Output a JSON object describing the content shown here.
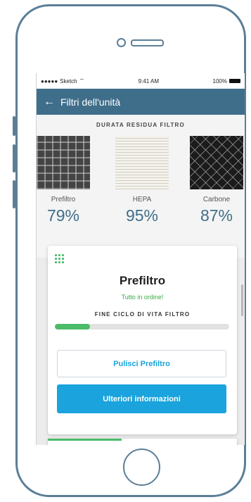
{
  "status_bar": {
    "carrier": "Sketch",
    "time": "9:41 AM",
    "battery": "100%"
  },
  "header": {
    "title": "Filtri dell'unità",
    "back_icon": "arrow-left-icon"
  },
  "filters": {
    "heading": "DURATA RESIDUA FILTRO",
    "items": [
      {
        "name": "Prefiltro",
        "percent": "79%"
      },
      {
        "name": "HEPA",
        "percent": "95%"
      },
      {
        "name": "Carbone",
        "percent": "87%"
      }
    ]
  },
  "card": {
    "title": "Prefiltro",
    "status": "Tutto in ordine!",
    "life_label": "FINE CICLO DI VITA FILTRO",
    "life_progress": 0.2,
    "clean_button": "Pulisci Prefiltro",
    "info_button": "Ulteriori informazioni"
  },
  "colors": {
    "accent": "#1aa3dc",
    "header": "#3f6e8a",
    "ok": "#4cbb6a"
  }
}
